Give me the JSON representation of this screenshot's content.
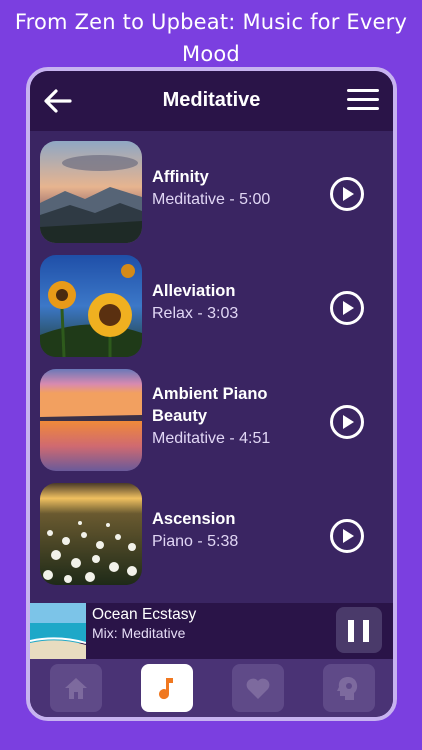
{
  "promo": {
    "headline": "From Zen to Upbeat: Music for Every Mood"
  },
  "header": {
    "title": "Meditative",
    "back_icon": "arrow-left-icon",
    "menu_icon": "hamburger-menu-icon"
  },
  "tracks": [
    {
      "title": "Affinity",
      "subtitle": "Meditative - 5:00",
      "art": "mountain-sunset"
    },
    {
      "title": "Alleviation",
      "subtitle": "Relax - 3:03",
      "art": "sunflowers"
    },
    {
      "title": "Ambient Piano Beauty",
      "subtitle": "Meditative - 4:51",
      "art": "lake-sunset"
    },
    {
      "title": "Ascension",
      "subtitle": "Piano - 5:38",
      "art": "daisy-field"
    }
  ],
  "now_playing": {
    "title": "Ocean Ecstasy",
    "subtitle": "Mix: Meditative",
    "art": "ocean-beach",
    "control_icon": "pause-icon"
  },
  "tabs": [
    {
      "name": "home",
      "icon": "home-icon",
      "active": false
    },
    {
      "name": "music",
      "icon": "music-note-icon",
      "active": true
    },
    {
      "name": "favorites",
      "icon": "heart-icon",
      "active": false
    },
    {
      "name": "mind",
      "icon": "head-gear-icon",
      "active": false
    }
  ],
  "colors": {
    "background": "#7b3fe0",
    "accent": "#f07820",
    "panel": "#3a2562"
  }
}
